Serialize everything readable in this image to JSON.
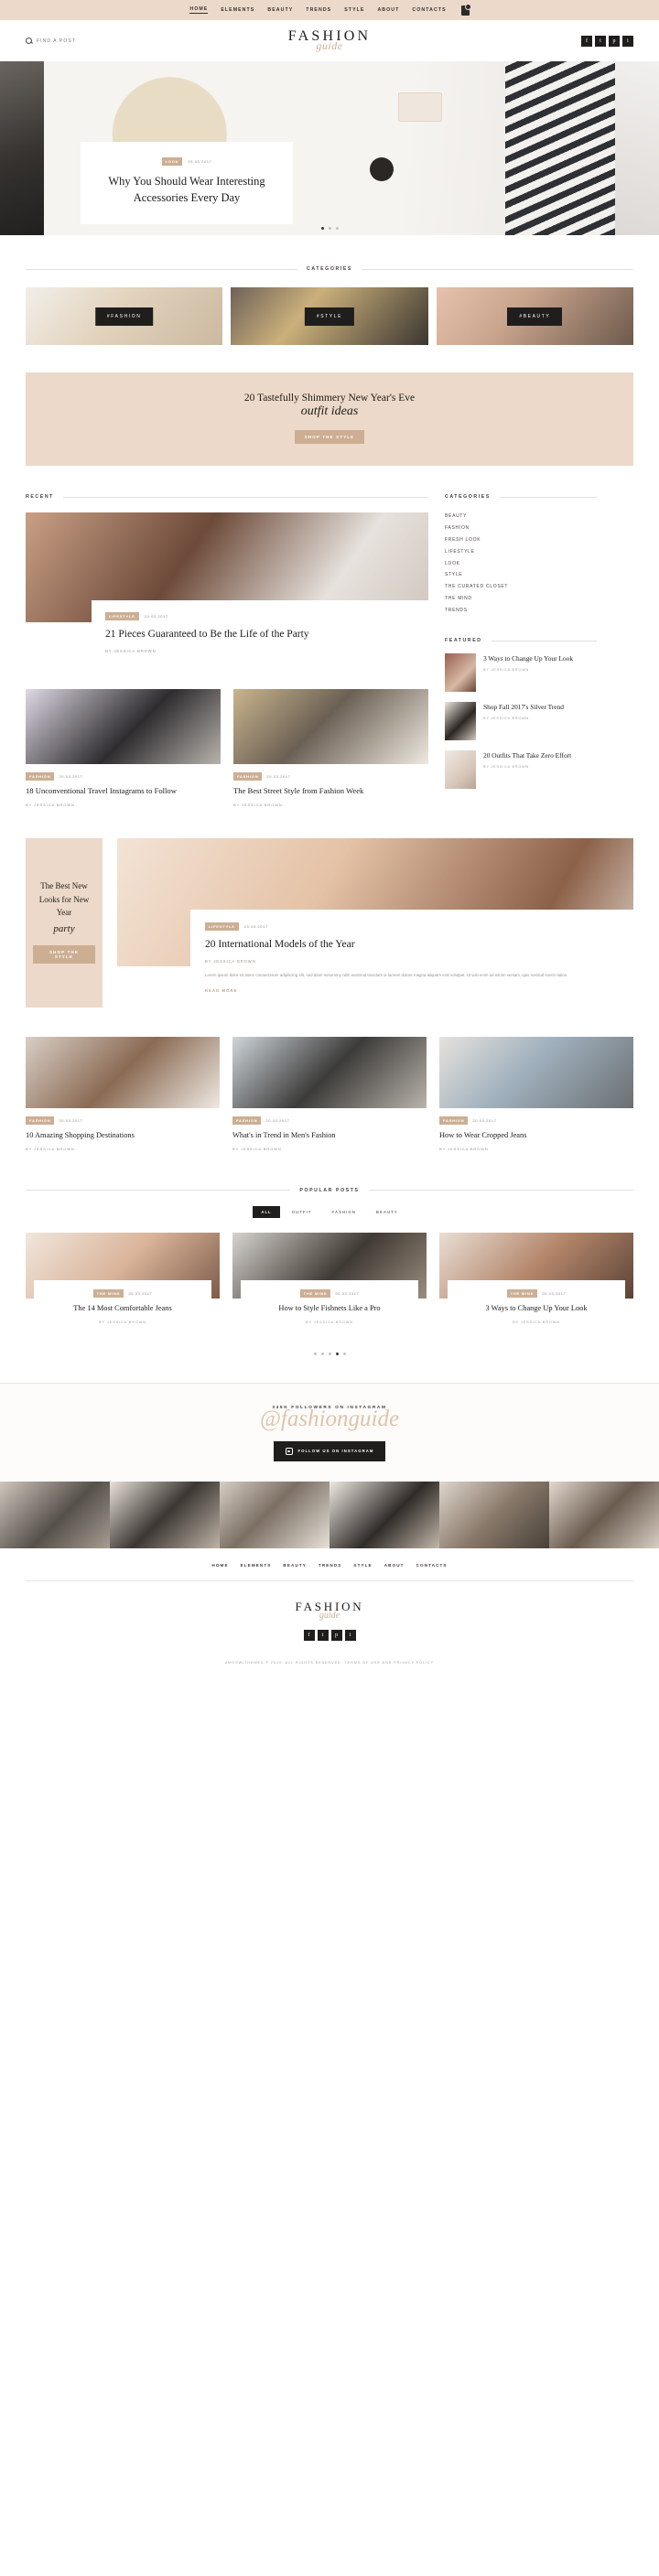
{
  "topnav": {
    "items": [
      {
        "label": "HOME",
        "active": true
      },
      {
        "label": "ELEMENTS",
        "active": false
      },
      {
        "label": "BEAUTY",
        "active": false
      },
      {
        "label": "TRENDS",
        "active": false
      },
      {
        "label": "STYLE",
        "active": false
      },
      {
        "label": "ABOUT",
        "active": false
      },
      {
        "label": "CONTACTS",
        "active": false
      }
    ],
    "cart_icon": "shopping-bag-icon"
  },
  "header": {
    "search_placeholder": "FIND A POST",
    "search_value": "",
    "logo_main": "FASHION",
    "logo_sub": "guide",
    "socials": [
      "f",
      "t",
      "p",
      "i"
    ]
  },
  "hero": {
    "category": "LOOK",
    "date": "20.03.2017",
    "title": "Why You Should Wear Interesting Accessories Every Day",
    "dots": 3,
    "active_dot": 0
  },
  "categories_section": {
    "heading": "CATEGORIES",
    "cards": [
      {
        "tag": "#FASHION"
      },
      {
        "tag": "#STYLE"
      },
      {
        "tag": "#BEAUTY"
      }
    ]
  },
  "promo": {
    "line1": "20 Tastefully Shimmery New Year's Eve",
    "line2": "outfit ideas",
    "button": "SHOP THE STYLE"
  },
  "recent": {
    "heading": "RECENT",
    "feature": {
      "category": "LIFESTYLE",
      "date": "20.03.2017",
      "title": "21 Pieces Guaranteed to Be the Life of the Party",
      "byline": "BY JESSICA BROWN"
    },
    "minis": [
      {
        "category": "FASHION",
        "date": "20.03.2017",
        "title": "18 Unconventional Travel Instagrams to Follow",
        "byline": "BY JESSICA BROWN"
      },
      {
        "category": "FASHION",
        "date": "20.03.2017",
        "title": "The Best Street Style from Fashion Week",
        "byline": "BY JESSICA BROWN"
      }
    ]
  },
  "sidebar": {
    "categories_heading": "CATEGORIES",
    "categories": [
      "BEAUTY",
      "FASHION",
      "FRESH LOOK",
      "LIFESTYLE",
      "LOOK",
      "STYLE",
      "THE CURATED CLOSET",
      "THE MIND",
      "TRENDS"
    ],
    "featured_heading": "FEATURED",
    "featured": [
      {
        "title": "3 Ways to Change Up Your Look",
        "byline": "BY JESSICA BROWN"
      },
      {
        "title": "Shop Fall 2017's Silver Trend",
        "byline": "BY JESSICA BROWN"
      },
      {
        "title": "20 Outfits That Take Zero Effort",
        "byline": "BY JESSICA BROWN"
      }
    ]
  },
  "split": {
    "promo": {
      "line1": "The Best New Looks for New Year",
      "line2": "party",
      "button": "SHOP THE STYLE"
    },
    "article": {
      "category": "LIFESTYLE",
      "date": "20.03.2017",
      "title": "20 International Models of the Year",
      "byline": "BY JESSICA BROWN",
      "excerpt": "Lorem ipsum dolor sit amet, consectetuer adipiscing elit, sed diam nonummy nibh euismod tincidunt ut laoreet dolore magna aliquam erat volutpat. Ut wisi enim ad minim veniam, quis nostrud exerci tation.",
      "readmore": "READ MORE"
    }
  },
  "three_cards": [
    {
      "category": "FASHION",
      "date": "20.03.2017",
      "title": "10 Amazing Shopping Destinations",
      "byline": "BY JESSICA BROWN"
    },
    {
      "category": "FASHION",
      "date": "20.03.2017",
      "title": "What's in Trend in Men's Fashion",
      "byline": "BY JESSICA BROWN"
    },
    {
      "category": "FASHION",
      "date": "20.03.2017",
      "title": "How to Wear Cropped Jeans",
      "byline": "BY JESSICA BROWN"
    }
  ],
  "popular": {
    "heading": "POPULAR POSTS",
    "tabs": [
      {
        "label": "ALL",
        "active": true
      },
      {
        "label": "OUTFIT",
        "active": false
      },
      {
        "label": "FASHION",
        "active": false
      },
      {
        "label": "BEAUTY",
        "active": false
      }
    ],
    "cards": [
      {
        "category": "THE MIND",
        "date": "20.03.2017",
        "title": "The 14 Most Comfortable Jeans",
        "byline": "BY JESSICA BROWN"
      },
      {
        "category": "THE MIND",
        "date": "20.03.2017",
        "title": "How to Style Fishnets Like a Pro",
        "byline": "BY JESSICA BROWN"
      },
      {
        "category": "THE MIND",
        "date": "20.03.2017",
        "title": "3 Ways to Change Up Your Look",
        "byline": "BY JESSICA BROWN"
      }
    ],
    "dots": 5,
    "active_dot": 3
  },
  "instagram": {
    "followers": "345K FOLLOWERS ON INSTAGRAM",
    "handle": "@fashionguide",
    "button": "FOLLOW US ON INSTAGRAM",
    "tiles": 6
  },
  "footer": {
    "nav": [
      "HOME",
      "ELEMENTS",
      "BEAUTY",
      "TRENDS",
      "STYLE",
      "ABOUT",
      "CONTACTS"
    ],
    "logo_main": "FASHION",
    "logo_sub": "guide",
    "socials": [
      "f",
      "t",
      "p",
      "i"
    ],
    "copyright": "AMOSWITHEMES © 2020. ALL RIGHTS RESERVED. TERMS OF USE AND PRIVACY POLICY"
  }
}
